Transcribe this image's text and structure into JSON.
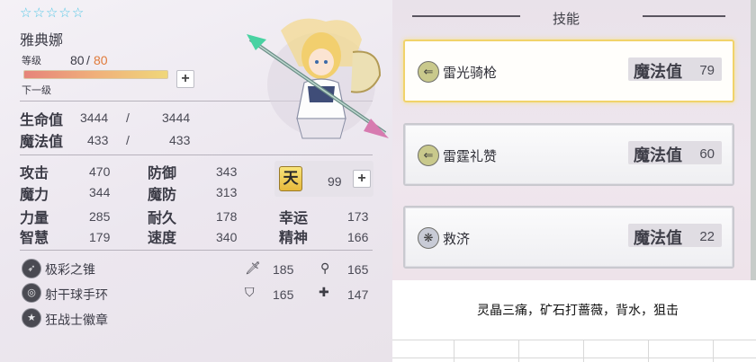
{
  "character": {
    "stars": [
      "☆",
      "☆",
      "☆",
      "☆",
      "☆"
    ],
    "name": "雅典娜",
    "level_label": "等级",
    "level_current": "80",
    "level_sep": "/",
    "level_max": "80",
    "next_label": "下一级",
    "hp_label": "生命值",
    "hp_current": "3444",
    "hp_sep": "/",
    "hp_max": "3444",
    "mp_label": "魔法值",
    "mp_current": "433",
    "mp_sep": "/",
    "mp_max": "433",
    "plus_symbol": "+"
  },
  "stats": {
    "attack_label": "攻击",
    "attack": "470",
    "defense_label": "防御",
    "defense": "343",
    "magic_label": "魔力",
    "magic": "344",
    "magic_def_label": "魔防",
    "magic_def": "313",
    "strength_label": "力量",
    "strength": "285",
    "endurance_label": "耐久",
    "endurance": "178",
    "luck_label": "幸运",
    "luck": "173",
    "wisdom_label": "智慧",
    "wisdom": "179",
    "speed_label": "速度",
    "speed": "340",
    "spirit_label": "精神",
    "spirit": "166",
    "tian_symbol": "天",
    "tian_value": "99"
  },
  "equipment": {
    "items": [
      {
        "label": "极彩之锥",
        "icon": "cone-icon"
      },
      {
        "label": "射干球手环",
        "icon": "bracelet-icon"
      },
      {
        "label": "狂战士徽章",
        "icon": "badge-icon"
      }
    ],
    "sword_value": "185",
    "wand_value": "165",
    "shield_value": "165",
    "cross_value": "147"
  },
  "skills": {
    "title": "技能",
    "mp_label": "魔法值",
    "list": [
      {
        "name": "雷光骑枪",
        "mp": "79",
        "icon": "lightning-lance-icon"
      },
      {
        "name": "雷霆礼赞",
        "mp": "60",
        "icon": "lightning-lance-icon"
      },
      {
        "name": "救济",
        "mp": "22",
        "icon": "snowflake-icon"
      }
    ]
  },
  "spreadsheet": {
    "note": "灵晶三痛，矿石打蔷薇，背水，狙击"
  },
  "colors": {
    "star": "#52c7e6",
    "level_max": "#e07a3a",
    "selected_border": "#f1d36a"
  }
}
